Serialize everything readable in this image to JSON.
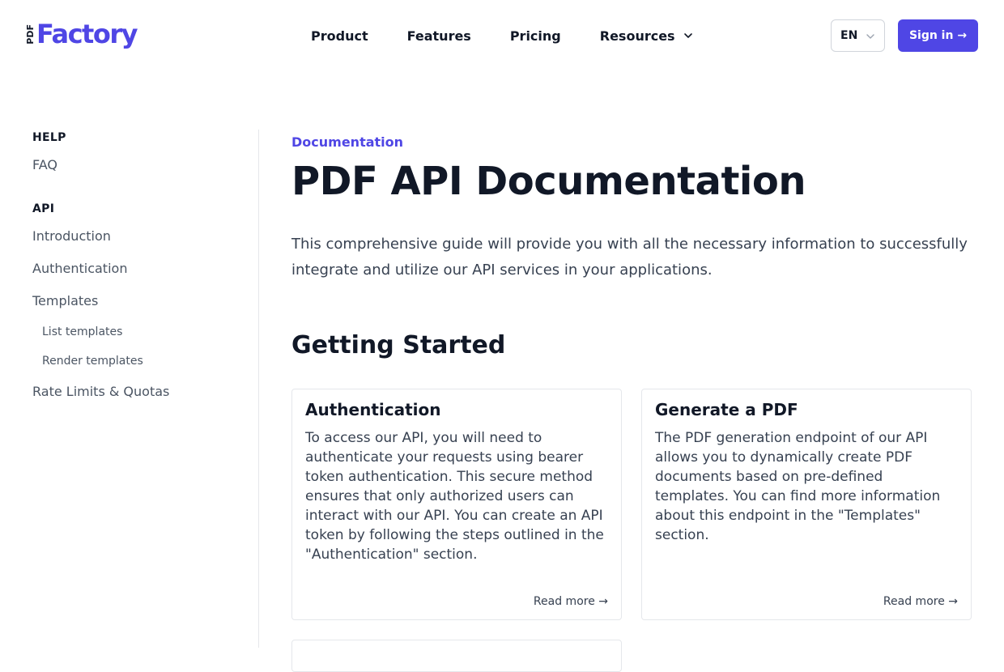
{
  "header": {
    "logo_prefix": "PDF",
    "logo_name": "Factory",
    "nav": [
      {
        "label": "Product"
      },
      {
        "label": "Features"
      },
      {
        "label": "Pricing"
      },
      {
        "label": "Resources"
      }
    ],
    "language": "EN",
    "signin_label": "Sign in →"
  },
  "sidebar": {
    "sections": [
      {
        "heading": "HELP",
        "items": [
          {
            "label": "FAQ"
          }
        ]
      },
      {
        "heading": "API",
        "items": [
          {
            "label": "Introduction"
          },
          {
            "label": "Authentication"
          },
          {
            "label": "Templates"
          },
          {
            "label": "List templates"
          },
          {
            "label": "Render templates"
          },
          {
            "label": "Rate Limits & Quotas"
          }
        ]
      }
    ]
  },
  "main": {
    "eyebrow": "Documentation",
    "title": "PDF API Documentation",
    "intro": "This comprehensive guide will provide you with all the necessary information to successfully integrate and utilize our API services in your applications.",
    "section_title": "Getting Started",
    "cards": [
      {
        "title": "Authentication",
        "body": "To access our API, you will need to authenticate your requests using bearer token authentication. This secure method ensures that only authorized users can interact with our API. You can create an API token by following the steps outlined in the \"Authentication\" section.",
        "more": "Read more →"
      },
      {
        "title": "Generate a PDF",
        "body": "The PDF generation endpoint of our API allows you to dynamically create PDF documents based on pre-defined templates. You can find more information about this endpoint in the \"Templates\" section.",
        "more": "Read more →"
      }
    ]
  },
  "colors": {
    "accent": "#4f46e5",
    "text": "#111827",
    "muted": "#4b5563",
    "border": "#e5e7eb"
  }
}
